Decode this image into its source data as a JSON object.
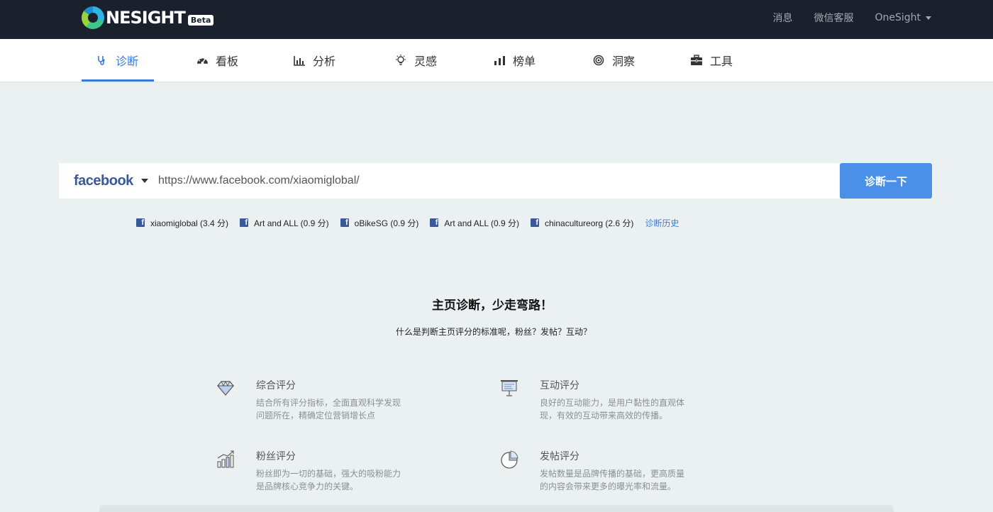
{
  "header": {
    "logo_text": "NESIGHT",
    "logo_badge": "Beta",
    "nav": [
      {
        "label": "消息"
      },
      {
        "label": "微信客服"
      },
      {
        "label": "OneSight"
      }
    ]
  },
  "tabs": [
    {
      "label": "诊断",
      "icon": "stethoscope-icon",
      "active": true
    },
    {
      "label": "看板",
      "icon": "dashboard-icon"
    },
    {
      "label": "分析",
      "icon": "bar-chart-icon"
    },
    {
      "label": "灵感",
      "icon": "lightbulb-icon"
    },
    {
      "label": "榜单",
      "icon": "signal-bars-icon"
    },
    {
      "label": "洞察",
      "icon": "target-icon"
    },
    {
      "label": "工具",
      "icon": "toolbox-icon"
    }
  ],
  "search": {
    "platform": "facebook",
    "value": "https://www.facebook.com/xiaomiglobal/",
    "button_label": "诊断一下"
  },
  "history": {
    "items": [
      {
        "label": "xiaomiglobal (3.4 分)"
      },
      {
        "label": "Art and ALL (0.9 分)"
      },
      {
        "label": "oBikeSG (0.9 分)"
      },
      {
        "label": "Art and ALL (0.9 分)"
      },
      {
        "label": "chinacultureorg (2.6 分)"
      }
    ],
    "link_label": "诊断历史"
  },
  "intro": {
    "title": "主页诊断，少走弯路！",
    "subtitle": "什么是判断主页评分的标准呢，粉丝？发帖？互动？"
  },
  "features": [
    {
      "title": "综合评分",
      "desc": "结合所有评分指标，全面直观科学发现问题所在，精确定位营销增长点",
      "icon": "diamond-icon"
    },
    {
      "title": "互动评分",
      "desc": "良好的互动能力，是用户黏性的直观体现，有效的互动带来高效的传播。",
      "icon": "presentation-icon"
    },
    {
      "title": "粉丝评分",
      "desc": "粉丝即为一切的基础，强大的吸粉能力是品牌核心竞争力的关键。",
      "icon": "growth-chart-icon"
    },
    {
      "title": "发帖评分",
      "desc": "发帖数量是品牌传播的基础，更高质量的内容会带来更多的曝光率和流量。",
      "icon": "pie-chart-icon"
    }
  ],
  "colors": {
    "accent": "#3b7bd6",
    "button": "#4a90e8",
    "topbar": "#1b212c",
    "facebook": "#3b5998"
  }
}
